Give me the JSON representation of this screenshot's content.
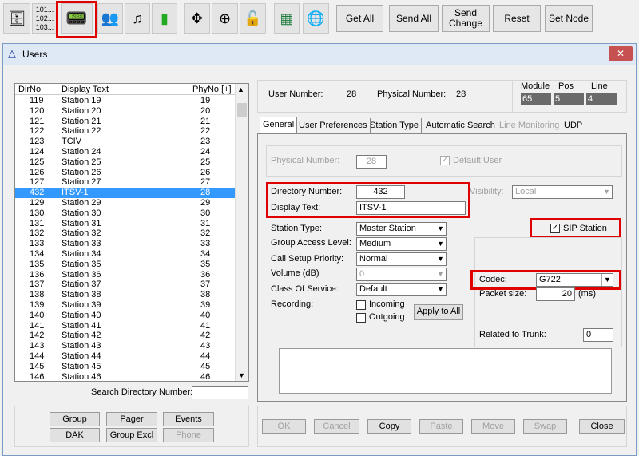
{
  "toolbar": {
    "icons": [
      "server-icon",
      "number-list-icon",
      "handset-icon",
      "group-icon",
      "music-icon",
      "pager-device-icon",
      "network-expand-icon",
      "node-icon",
      "lock-icon",
      "excel-icon",
      "globe-icon"
    ],
    "numbers": [
      "101...",
      "102...",
      "103..."
    ],
    "buttons": [
      "Get All",
      "Send All",
      "Send Change",
      "Reset",
      "Set Node"
    ]
  },
  "window": {
    "title": "Users",
    "close": "✕"
  },
  "list": {
    "headers": [
      "DirNo",
      "Display Text",
      "PhyNo [+]"
    ],
    "rows": [
      [
        "119",
        "Station 19",
        "19"
      ],
      [
        "120",
        "Station 20",
        "20"
      ],
      [
        "121",
        "Station 21",
        "21"
      ],
      [
        "122",
        "Station 22",
        "22"
      ],
      [
        "123",
        "TCIV",
        "23"
      ],
      [
        "124",
        "Station 24",
        "24"
      ],
      [
        "125",
        "Station 25",
        "25"
      ],
      [
        "126",
        "Station 26",
        "26"
      ],
      [
        "127",
        "Station 27",
        "27"
      ],
      [
        "432",
        "ITSV-1",
        "28"
      ],
      [
        "129",
        "Station 29",
        "29"
      ],
      [
        "130",
        "Station 30",
        "30"
      ],
      [
        "131",
        "Station 31",
        "31"
      ],
      [
        "132",
        "Station 32",
        "32"
      ],
      [
        "133",
        "Station 33",
        "33"
      ],
      [
        "134",
        "Station 34",
        "34"
      ],
      [
        "135",
        "Station 35",
        "35"
      ],
      [
        "136",
        "Station 36",
        "36"
      ],
      [
        "137",
        "Station 37",
        "37"
      ],
      [
        "138",
        "Station 38",
        "38"
      ],
      [
        "139",
        "Station 39",
        "39"
      ],
      [
        "140",
        "Station 40",
        "40"
      ],
      [
        "141",
        "Station 41",
        "41"
      ],
      [
        "142",
        "Station 42",
        "42"
      ],
      [
        "143",
        "Station 43",
        "43"
      ],
      [
        "144",
        "Station 44",
        "44"
      ],
      [
        "145",
        "Station 45",
        "45"
      ],
      [
        "146",
        "Station 46",
        "46"
      ]
    ],
    "selected_index": 9,
    "search_label": "Search Directory Number:",
    "search_value": ""
  },
  "left_buttons": [
    {
      "label": "Group",
      "enabled": true
    },
    {
      "label": "Pager",
      "enabled": true
    },
    {
      "label": "Events",
      "enabled": true
    },
    {
      "label": "DAK",
      "enabled": true
    },
    {
      "label": "Group Excl",
      "enabled": true
    },
    {
      "label": "Phone",
      "enabled": false
    }
  ],
  "info": {
    "user_number_label": "User Number:",
    "user_number": "28",
    "physical_number_label": "Physical Number:",
    "physical_number": "28",
    "module_label": "Module",
    "module": "65",
    "pos_label": "Pos",
    "pos": "5",
    "line_label": "Line",
    "line": "4"
  },
  "tabs": [
    {
      "label": "General",
      "active": true
    },
    {
      "label": "User Preferences"
    },
    {
      "label": "Station Type"
    },
    {
      "label": "Automatic Search"
    },
    {
      "label": "Line Monitoring",
      "disabled": true
    },
    {
      "label": "UDP"
    }
  ],
  "general": {
    "physical_number_label": "Physical Number:",
    "physical_number": "28",
    "default_user_label": "Default User",
    "directory_number_label": "Directory Number:",
    "directory_number": "432",
    "display_text_label": "Display Text:",
    "display_text": "ITSV-1",
    "visibility_label": "Visibility:",
    "visibility": "Local",
    "station_type_label": "Station Type:",
    "station_type": "Master Station",
    "group_access_label": "Group Access Level:",
    "group_access": "Medium",
    "call_setup_label": "Call Setup Priority:",
    "call_setup": "Normal",
    "volume_label": "Volume (dB)",
    "volume": "0",
    "cos_label": "Class Of Service:",
    "cos": "Default",
    "recording_label": "Recording:",
    "incoming_label": "Incoming",
    "outgoing_label": "Outgoing",
    "apply_all": "Apply to All",
    "sip_label": "SIP Station",
    "sip_checked": true,
    "codec_label": "Codec:",
    "codec": "G722",
    "packet_label": "Packet size:",
    "packet": "20",
    "packet_unit": "(ms)",
    "trunk_label": "Related to Trunk:",
    "trunk": "0"
  },
  "bottom_buttons": [
    {
      "label": "OK",
      "enabled": false
    },
    {
      "label": "Cancel",
      "enabled": false
    },
    {
      "label": "Copy",
      "enabled": true
    },
    {
      "label": "Paste",
      "enabled": false
    },
    {
      "label": "Move",
      "enabled": false
    },
    {
      "label": "Swap",
      "enabled": false
    },
    {
      "label": "Close",
      "enabled": true
    }
  ],
  "colors": {
    "highlight": "#e00000",
    "selection": "#3399ff"
  }
}
